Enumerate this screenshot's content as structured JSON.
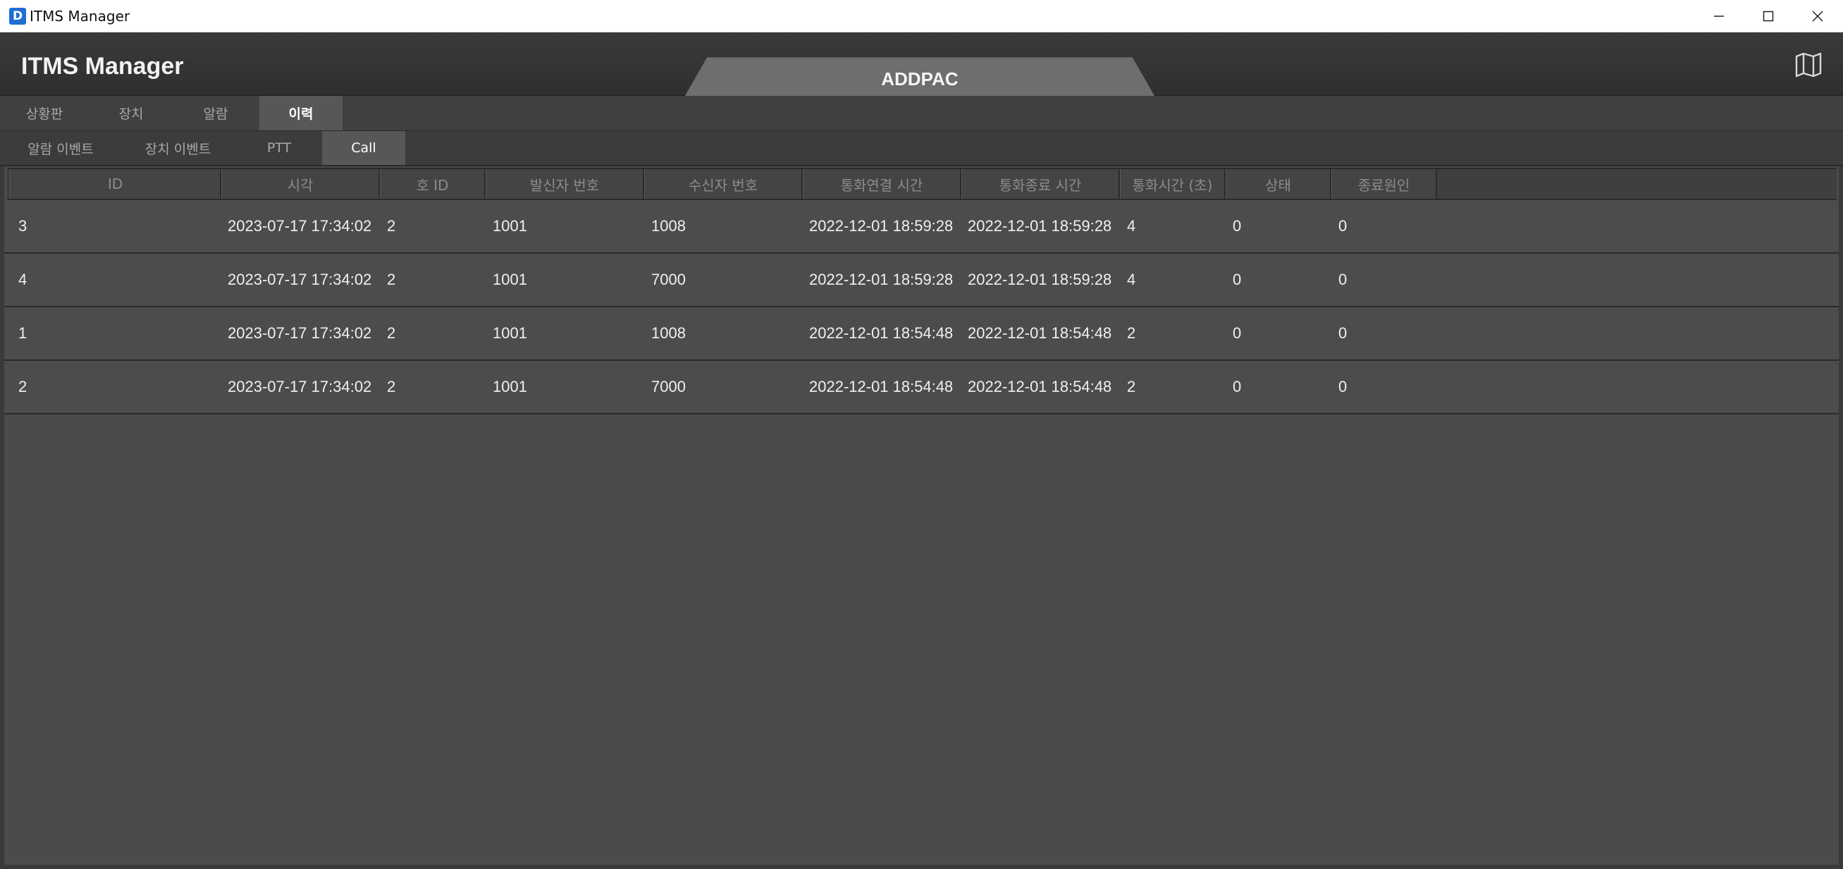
{
  "window": {
    "title": "ITMS Manager",
    "logo_letter": "D",
    "controls": [
      "minimize",
      "maximize",
      "close"
    ]
  },
  "header": {
    "app_title": "ITMS Manager",
    "center_tab_label": "ADDPAC",
    "right_icon": "map-icon"
  },
  "main_nav": {
    "items": [
      {
        "label": "상황판",
        "active": false
      },
      {
        "label": "장치",
        "active": false
      },
      {
        "label": "알람",
        "active": false
      },
      {
        "label": "이력",
        "active": true
      }
    ]
  },
  "sub_nav": {
    "items": [
      {
        "label": "알람 이벤트",
        "active": false
      },
      {
        "label": "장치 이벤트",
        "active": false
      },
      {
        "label": "PTT",
        "active": false
      },
      {
        "label": "Call",
        "active": true
      }
    ]
  },
  "table": {
    "columns": [
      "ID",
      "시각",
      "호 ID",
      "발신자 번호",
      "수신자 번호",
      "통화연결 시간",
      "통화종료 시간",
      "통화시간 (초)",
      "상태",
      "종료원인"
    ],
    "rows": [
      [
        "3",
        "2023-07-17 17:34:02",
        "2",
        "1001",
        "1008",
        "2022-12-01 18:59:28",
        "2022-12-01 18:59:28",
        "4",
        "0",
        "0"
      ],
      [
        "4",
        "2023-07-17 17:34:02",
        "2",
        "1001",
        "7000",
        "2022-12-01 18:59:28",
        "2022-12-01 18:59:28",
        "4",
        "0",
        "0"
      ],
      [
        "1",
        "2023-07-17 17:34:02",
        "2",
        "1001",
        "1008",
        "2022-12-01 18:54:48",
        "2022-12-01 18:54:48",
        "2",
        "0",
        "0"
      ],
      [
        "2",
        "2023-07-17 17:34:02",
        "2",
        "1001",
        "7000",
        "2022-12-01 18:54:48",
        "2022-12-01 18:54:48",
        "2",
        "0",
        "0"
      ]
    ]
  },
  "colors": {
    "header_bg": "#343434",
    "nav_bg": "#404040",
    "active_tab_bg": "#575757",
    "content_bg": "#4b4b4b",
    "accent_blue": "#1f6fd1"
  }
}
